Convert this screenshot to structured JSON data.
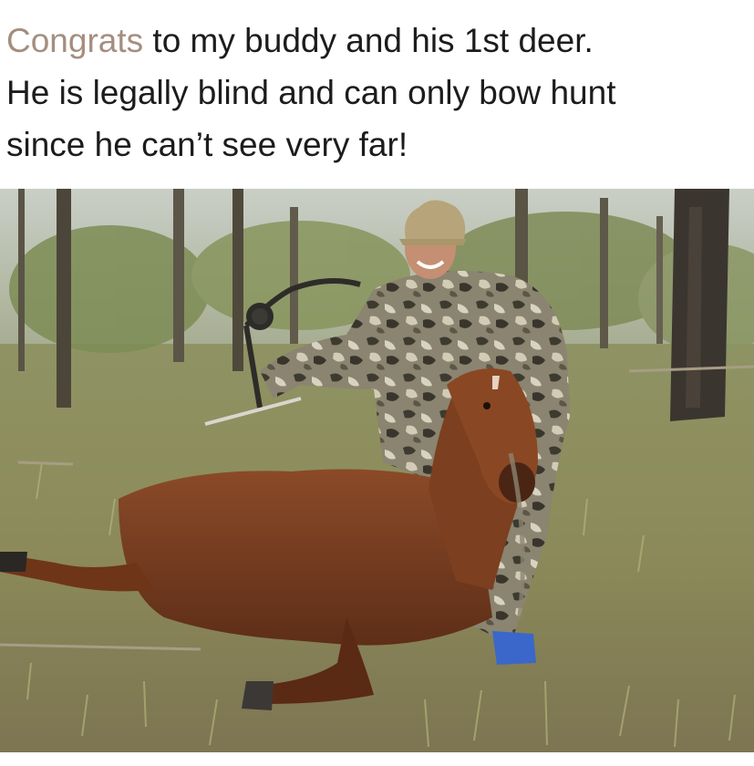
{
  "post": {
    "caption": {
      "highlight": "Congrats",
      "line1_rest": " to my buddy and his 1st deer.",
      "line2": "He is legally blind and can only bow hunt",
      "line3": "since he can’t see very far!"
    },
    "colors": {
      "highlight_text": "#a58e7f",
      "body_text": "#1c1c1c",
      "horse": "#7a3f22",
      "camo": "#6e6a55",
      "grass": "#9a9a62"
    }
  }
}
